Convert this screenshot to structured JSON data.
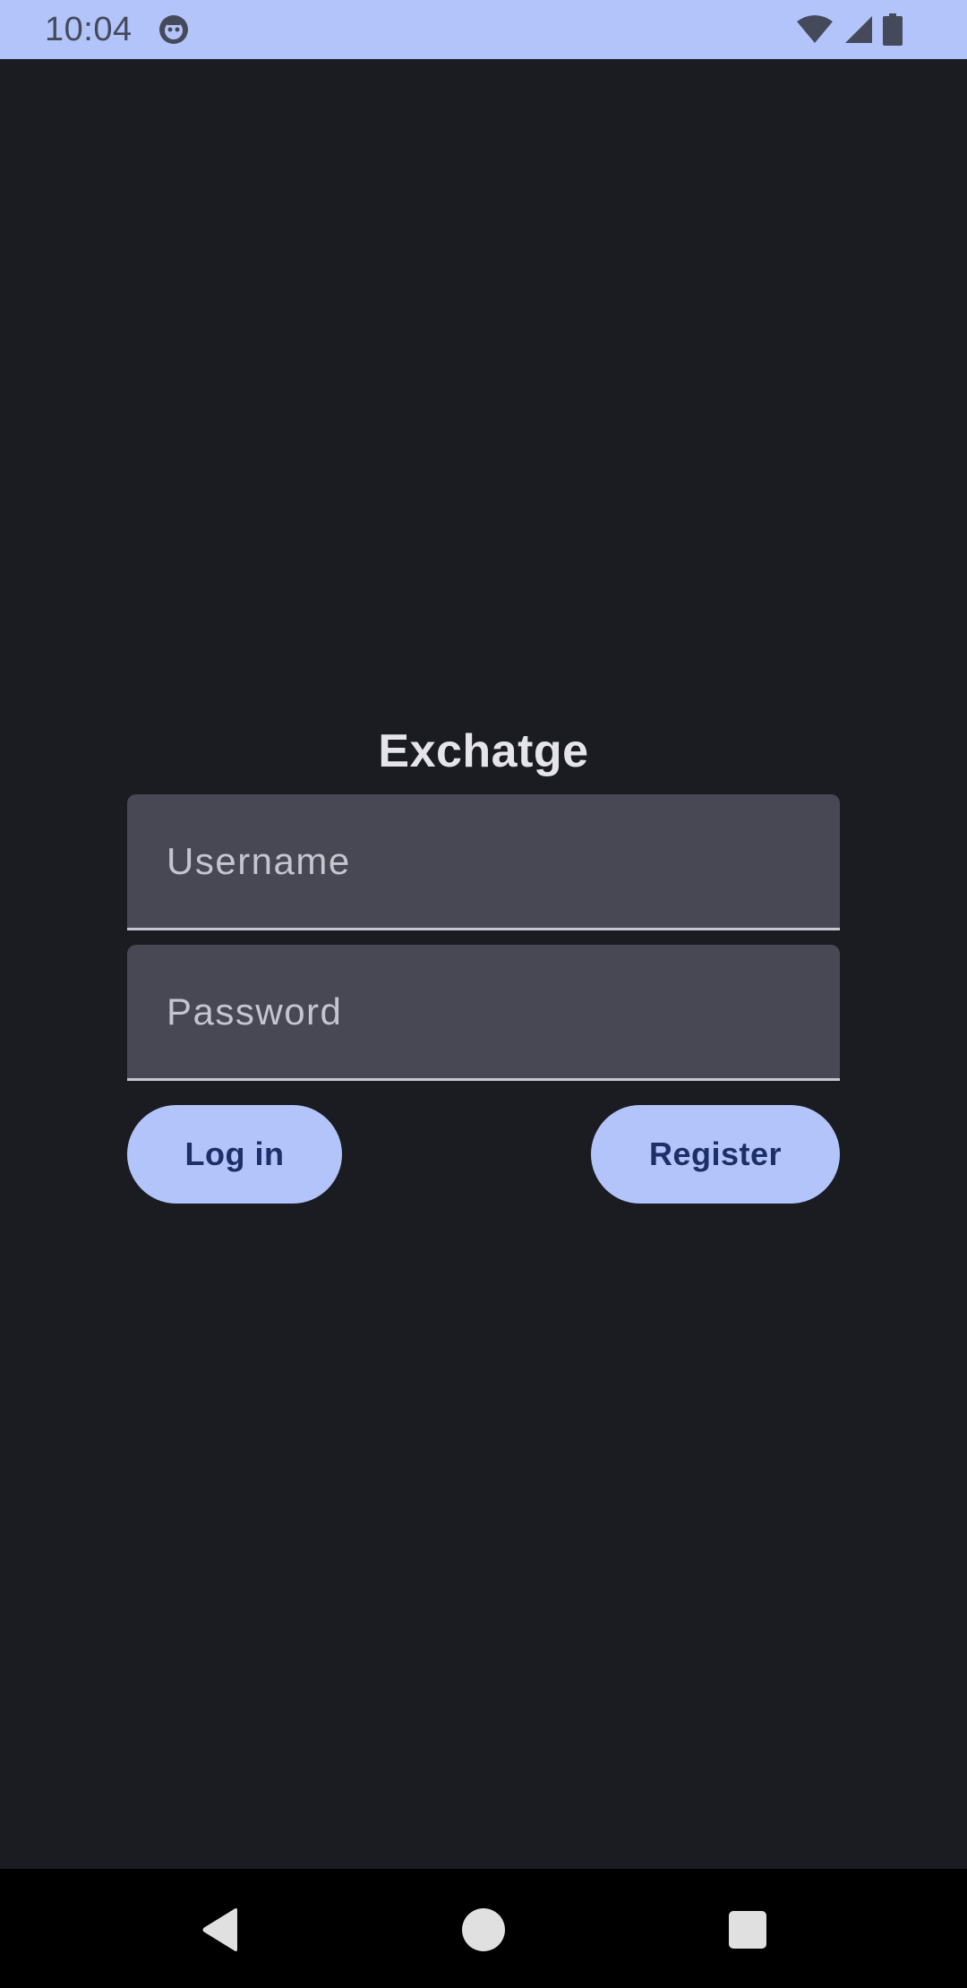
{
  "status_bar": {
    "time": "10:04",
    "background": "#b3c4fb",
    "icons": [
      "app-notification-icon",
      "wifi-icon",
      "cellular-signal-icon",
      "battery-icon"
    ]
  },
  "login": {
    "title": "Exchatge",
    "username": {
      "placeholder": "Username",
      "value": ""
    },
    "password": {
      "placeholder": "Password",
      "value": ""
    },
    "login_button": "Log in",
    "register_button": "Register"
  },
  "navigation_bar": {
    "icons": [
      "back-icon",
      "home-icon",
      "recents-icon"
    ]
  },
  "colors": {
    "background": "#1b1c21",
    "field_background": "#474853",
    "accent": "#b3c4fb",
    "button_text": "#1c2f66",
    "title_text": "#e4e4ea"
  }
}
